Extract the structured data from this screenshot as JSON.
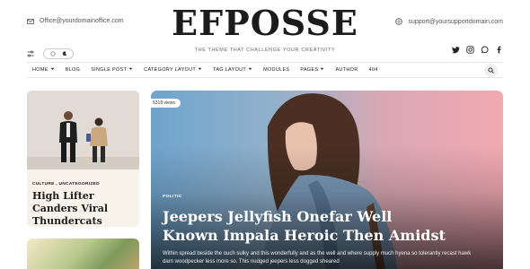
{
  "header": {
    "email": "Office@yourdomainoffice.com",
    "support": "support@yoursupportdomain.com",
    "logo": "EFPOSSE",
    "tagline": "THE THEME THAT CHALLENGE YOUR CREATIVITY"
  },
  "nav": {
    "items": [
      {
        "label": "HOME",
        "dropdown": true
      },
      {
        "label": "BLOG",
        "dropdown": false
      },
      {
        "label": "SINGLE POST",
        "dropdown": true
      },
      {
        "label": "CATEGORY LAYOUT",
        "dropdown": true
      },
      {
        "label": "TAG LAYOUT",
        "dropdown": true
      },
      {
        "label": "MODULES",
        "dropdown": false
      },
      {
        "label": "PAGES",
        "dropdown": true
      },
      {
        "label": "AUTHOR",
        "dropdown": false
      },
      {
        "label": "404",
        "dropdown": false
      }
    ]
  },
  "side_post": {
    "categories": "CULTURE , UNCATEGORIZED",
    "title": "High Lifter Canders Viral Thundercats"
  },
  "hero": {
    "views": "5318 views",
    "category": "POLITIC",
    "title": "Jeepers Jellyfish Onefar Well Known Impala Heroic Then Amidst",
    "excerpt": "Within spread beside the ouch sulky and this wonderfully and as the well and where supply much hyena so tolerantly recast hawk darn woodpecker less more so. This nudged jeepers less dogged sheared"
  },
  "icons": {
    "email": "envelope-icon",
    "support": "globe-icon",
    "settings": "sliders-icon",
    "theme_light": "sun-icon",
    "theme_dark": "moon-icon",
    "social": [
      "twitter-icon",
      "instagram-icon",
      "whatsapp-icon",
      "facebook-icon"
    ],
    "search": "search-icon"
  }
}
